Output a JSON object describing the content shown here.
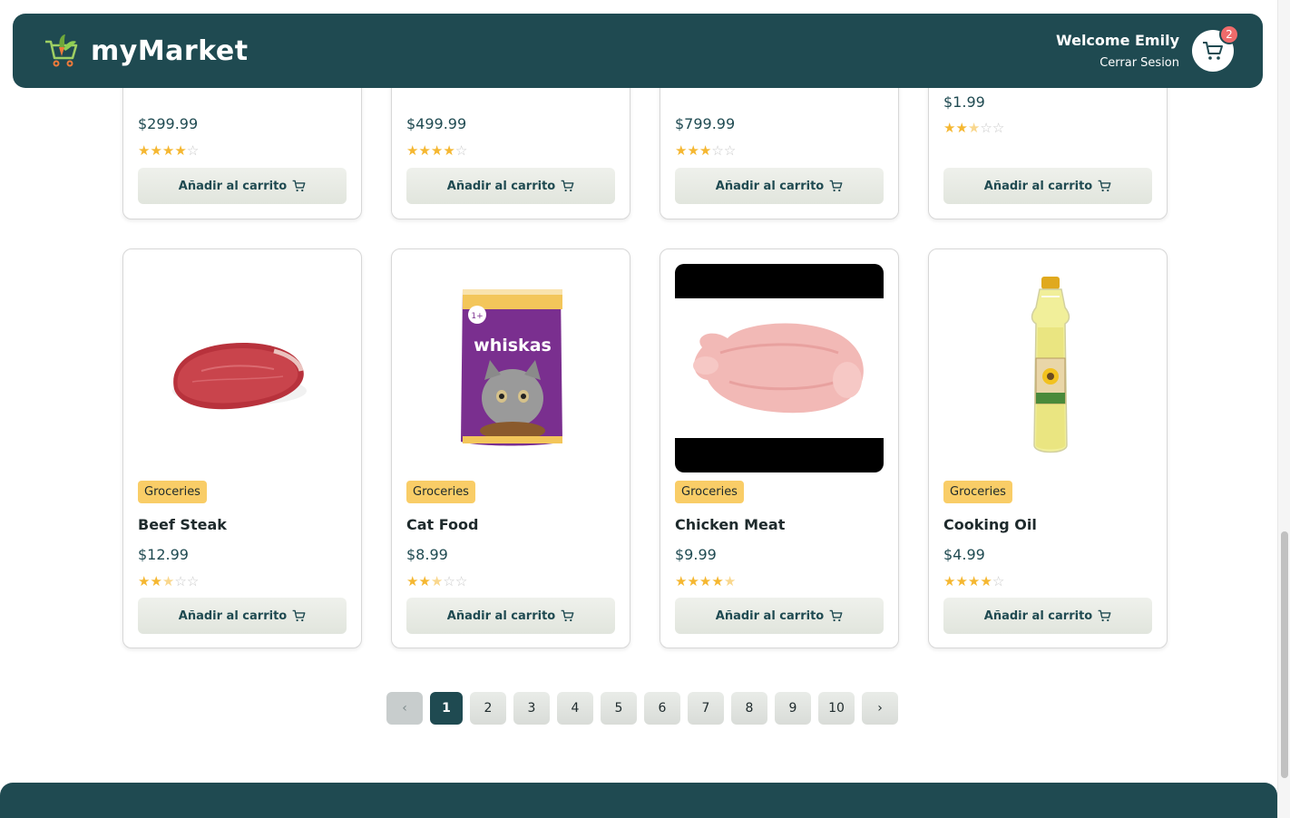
{
  "header": {
    "brand": "myMarket",
    "welcome": "Welcome Emily",
    "logout": "Cerrar Sesion",
    "cart_count": "2"
  },
  "top_row": [
    {
      "price": "$299.99",
      "rating": 4
    },
    {
      "price": "$499.99",
      "rating": 4
    },
    {
      "price": "$799.99",
      "rating": 3
    },
    {
      "price": "$1.99",
      "rating": 2.5
    }
  ],
  "products": [
    {
      "category": "Groceries",
      "name": "Beef Steak",
      "price": "$12.99",
      "rating": 2.5
    },
    {
      "category": "Groceries",
      "name": "Cat Food",
      "price": "$8.99",
      "rating": 2.5
    },
    {
      "category": "Groceries",
      "name": "Chicken Meat",
      "price": "$9.99",
      "rating": 4.5
    },
    {
      "category": "Groceries",
      "name": "Cooking Oil",
      "price": "$4.99",
      "rating": 4
    }
  ],
  "add_to_cart_label": "Añadir al carrito",
  "pagination": {
    "prev": "‹",
    "pages": [
      "1",
      "2",
      "3",
      "4",
      "5",
      "6",
      "7",
      "8",
      "9",
      "10"
    ],
    "current": "1",
    "next": "›"
  },
  "colors": {
    "primary": "#1f4a51",
    "badge": "#f9cd67",
    "star": "#f5b731",
    "cart_badge": "#f06b6b"
  }
}
